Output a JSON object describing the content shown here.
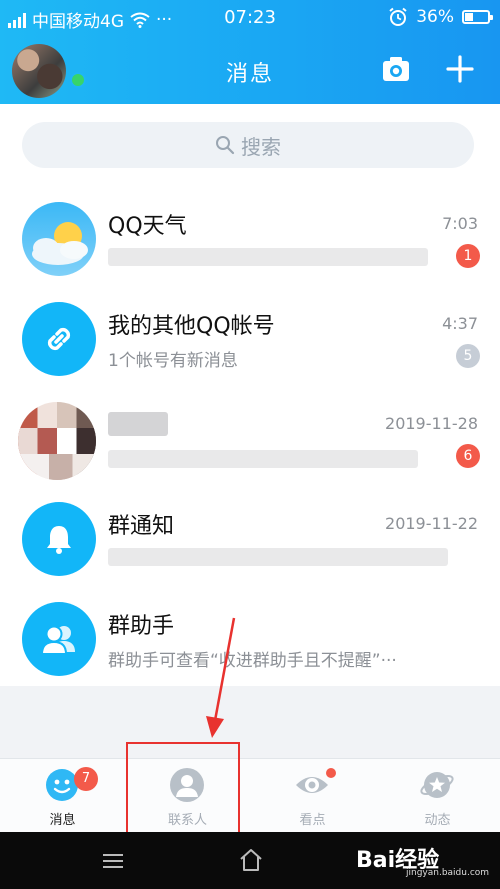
{
  "status_bar": {
    "carrier": "中国移动4G",
    "more": "···",
    "time": "07:23",
    "battery": "36%"
  },
  "header": {
    "title": "消息"
  },
  "search": {
    "placeholder": "搜索"
  },
  "messages": [
    {
      "name": "QQ天气",
      "preview": "",
      "time": "7:03",
      "badge": "1",
      "icon": "weather-icon"
    },
    {
      "name": "我的其他QQ帐号",
      "preview": "1个帐号有新消息",
      "time": "4:37",
      "badge": "5",
      "icon": "link-icon"
    },
    {
      "name": "",
      "preview": "",
      "time": "2019-11-28",
      "badge": "6",
      "icon": "avatar"
    },
    {
      "name": "群通知",
      "preview": "",
      "time": "2019-11-22",
      "badge": "",
      "icon": "bell-icon"
    },
    {
      "name": "群助手",
      "preview": "群助手可查看“收进群助手且不提醒”···",
      "time": "",
      "badge": "",
      "icon": "group-icon"
    }
  ],
  "tabs": [
    {
      "label": "消息",
      "badge": "7",
      "icon": "message-tab-icon",
      "active": true
    },
    {
      "label": "联系人",
      "icon": "contacts-tab-icon"
    },
    {
      "label": "看点",
      "icon": "eye-tab-icon",
      "dot": true
    },
    {
      "label": "动态",
      "icon": "star-planet-tab-icon"
    }
  ],
  "watermark": {
    "brand": "Bai经验",
    "url": "jingyan.baidu.com"
  },
  "colors": {
    "header": "#1aa7f3",
    "accent_blue": "#12b6f8",
    "badge_red": "#f35a4a",
    "annotation_red": "#e8322f"
  }
}
